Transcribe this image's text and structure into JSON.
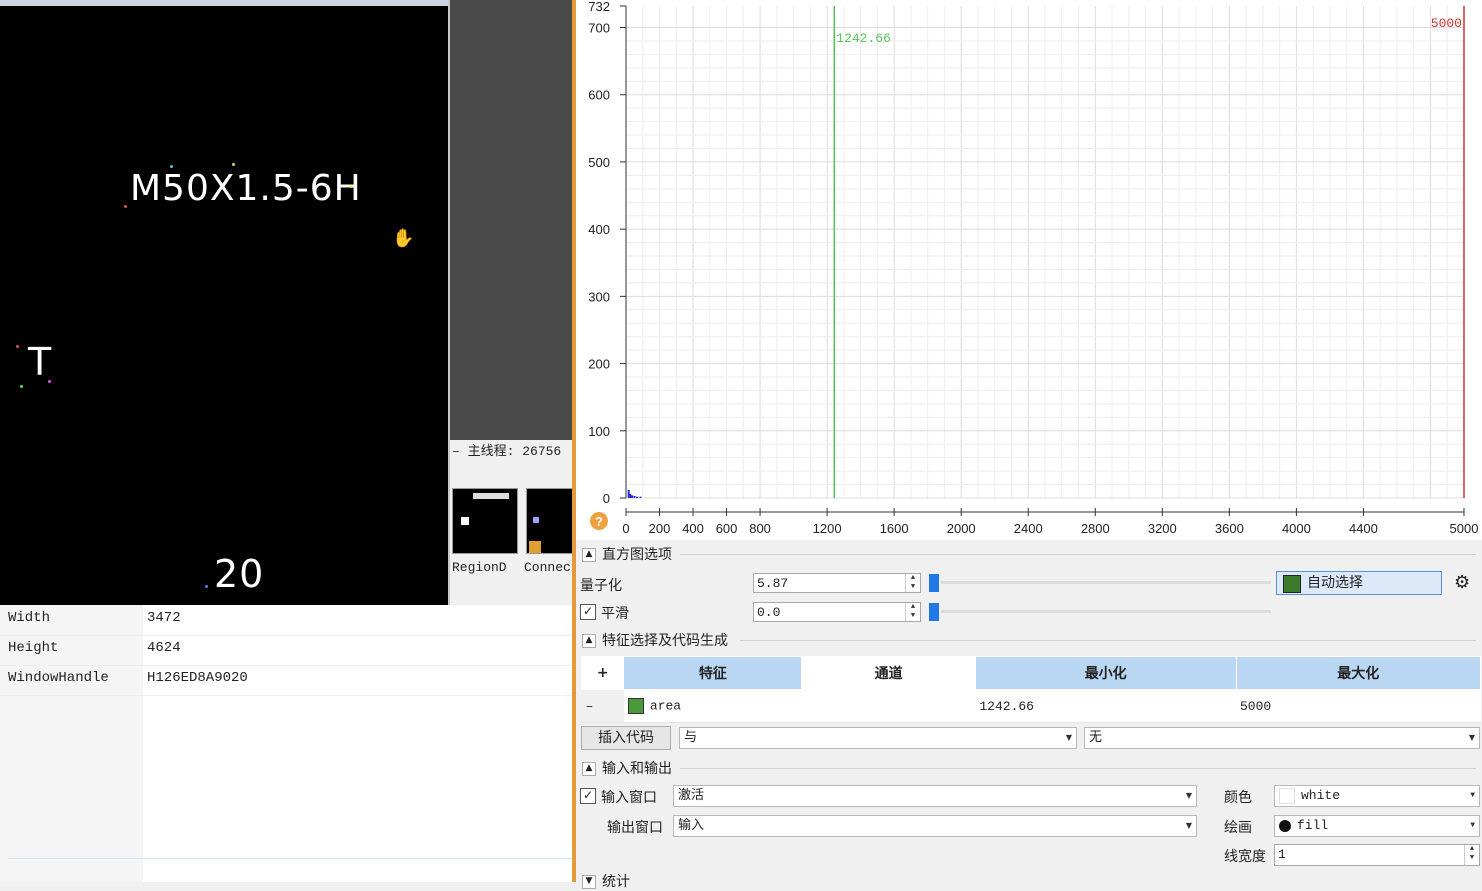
{
  "image_window": {
    "ocr_main": "M50X1.5-6H",
    "ocr_t": "T",
    "ocr_num": "20"
  },
  "thread_bar": "主线程: 26756",
  "thumbnails": [
    {
      "label": "RegionD"
    },
    {
      "label": "Connec"
    }
  ],
  "properties": [
    {
      "key": "Width",
      "value": "3472"
    },
    {
      "key": "Height",
      "value": "4624"
    },
    {
      "key": "WindowHandle",
      "value": "H126ED8A9020"
    }
  ],
  "chart_data": {
    "type": "line",
    "x_ticks": [
      "0",
      "200",
      "400",
      "600",
      "800",
      "1200",
      "1600",
      "2000",
      "2400",
      "2800",
      "3200",
      "3600",
      "4000",
      "4400",
      "5000"
    ],
    "y_ticks": [
      "0",
      "100",
      "200",
      "300",
      "400",
      "500",
      "600",
      "700",
      "732"
    ],
    "xlim": [
      0,
      5000
    ],
    "ylim": [
      0,
      732
    ],
    "threshold_min": 1242.66,
    "threshold_min_label": "1242.66",
    "threshold_max": 5000,
    "threshold_max_label": "5000",
    "grid": true,
    "colors": {
      "grid": "#e3e3e3",
      "min_line": "#58c458",
      "max_line": "#cc3333",
      "bars": "#2a2ad8"
    }
  },
  "histogram_options": {
    "title": "直方图选项",
    "quantize_label": "量子化",
    "quantize_value": "5.87",
    "smooth_label": "平滑",
    "smooth_value": "0.0",
    "smooth_checked": true,
    "auto_select_label": "自动选择"
  },
  "feature_section": {
    "title": "特征选择及代码生成",
    "columns": [
      "特征",
      "通道",
      "最小化",
      "最大化"
    ],
    "rows": [
      {
        "feature": "area",
        "channel": "",
        "min": "1242.66",
        "max": "5000"
      }
    ],
    "insert_code_label": "插入代码",
    "combo_and": "与",
    "combo_none": "无"
  },
  "io_section": {
    "title": "输入和输出",
    "input_window_label": "输入窗口",
    "input_window_value": "激活",
    "input_checked": true,
    "output_window_label": "输出窗口",
    "output_window_value": "输入",
    "color_label": "颜色",
    "color_value": "white",
    "draw_label": "绘画",
    "draw_value": "fill",
    "linewidth_label": "线宽度",
    "linewidth_value": "1"
  },
  "stats_section": {
    "title": "统计"
  }
}
